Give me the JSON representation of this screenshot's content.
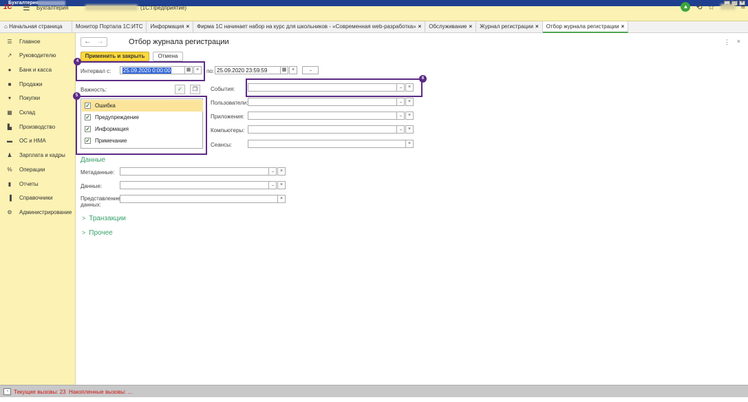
{
  "window": {
    "title": "Бухгалтерия"
  },
  "header": {
    "app_name": "Бухгалтерия",
    "app_subtitle": "(1С:Предприятие)",
    "logo_text": "1С"
  },
  "tabs": [
    {
      "label": "Начальная страница",
      "closable": false
    },
    {
      "label": "Монитор Портала 1С:ИТС",
      "closable": false
    },
    {
      "label": "Информация",
      "closable": true
    },
    {
      "label": "Фирма 1С начинает набор на курс для школьников - «Современная web-разработка»",
      "closable": true
    },
    {
      "label": "Обслуживание",
      "closable": true
    },
    {
      "label": "Журнал регистрации",
      "closable": true
    },
    {
      "label": "Отбор журнала регистрации",
      "closable": true
    }
  ],
  "sidebar": {
    "items": [
      {
        "label": "Главное",
        "icon": "list-icon"
      },
      {
        "label": "Руководителю",
        "icon": "trend-icon"
      },
      {
        "label": "Банк и касса",
        "icon": "coin-icon"
      },
      {
        "label": "Продажи",
        "icon": "bag-icon"
      },
      {
        "label": "Покупки",
        "icon": "cart-icon"
      },
      {
        "label": "Склад",
        "icon": "warehouse-icon"
      },
      {
        "label": "Производство",
        "icon": "factory-icon"
      },
      {
        "label": "ОС и НМА",
        "icon": "truck-icon"
      },
      {
        "label": "Зарплата и кадры",
        "icon": "person-icon"
      },
      {
        "label": "Операции",
        "icon": "operations-icon"
      },
      {
        "label": "Отчеты",
        "icon": "chart-icon"
      },
      {
        "label": "Справочники",
        "icon": "book-icon"
      },
      {
        "label": "Администрирование",
        "icon": "gear-icon"
      }
    ]
  },
  "form": {
    "title": "Отбор журнала регистрации",
    "apply_button": "Применить и закрыть",
    "cancel_button": "Отмена",
    "interval_from_label": "Интервал с:",
    "interval_from_value": "25.09.2020  0:00:00",
    "interval_to_label": "по:",
    "interval_to_value": "25.09.2020 23:59:59",
    "period_button": "...",
    "severity_label": "Важность:",
    "severity": [
      {
        "label": "Ошибка",
        "checked": true
      },
      {
        "label": "Предупреждение",
        "checked": true
      },
      {
        "label": "Информация",
        "checked": true
      },
      {
        "label": "Примечание",
        "checked": true
      }
    ],
    "events_label": "События:",
    "users_label": "Пользователи:",
    "apps_label": "Приложения:",
    "computers_label": "Компьютеры:",
    "sessions_label": "Сеансы:",
    "data_section": "Данные",
    "metadata_label": "Метаданные:",
    "data_label": "Данные:",
    "data_repr_label": "Представление данных:",
    "transactions_section": "Транзакции",
    "other_section": "Прочее"
  },
  "badges": {
    "interval": "4",
    "severity": "5",
    "events": "6"
  },
  "statusbar": {
    "current_calls": "Текущие вызовы: 23",
    "accumulated_calls": "Накопленные вызовы: ..."
  },
  "colors": {
    "accent_yellow": "#ffd83a",
    "sidebar_bg": "#fbf2b3",
    "highlight_purple": "#5b2a86",
    "section_green": "#3aa06a"
  }
}
